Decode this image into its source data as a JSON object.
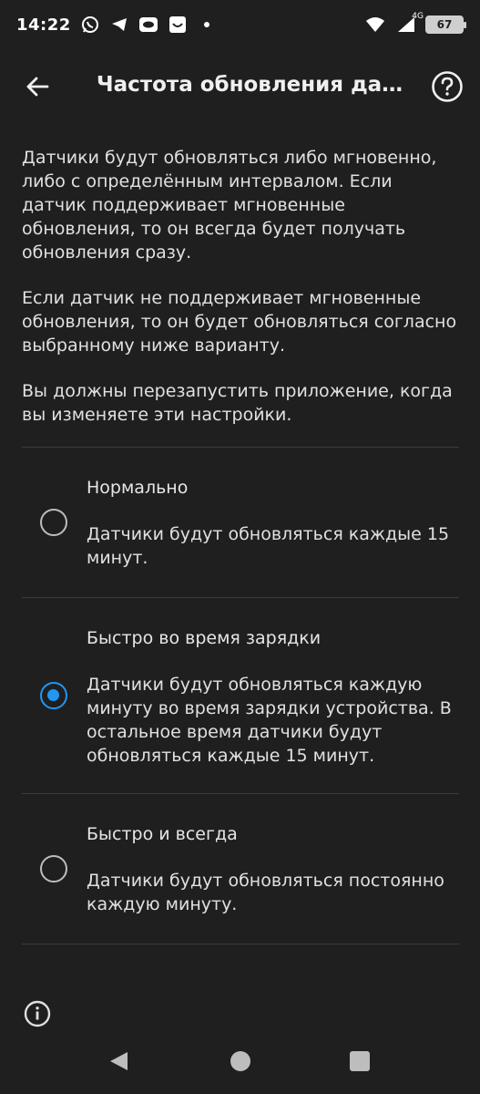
{
  "status": {
    "time": "14:22",
    "network": "4G",
    "battery": "67"
  },
  "app_bar": {
    "title": "Частота обновления датчиков"
  },
  "description": {
    "p1": "Датчики будут обновляться либо мгновенно, либо с определённым интервалом. Если датчик поддерживает мгновенные обновления, то он всегда будет получать обновления сразу.",
    "p2": "Если датчик не поддерживает мгновенные обновления, то он будет обновляться согласно выбранному ниже варианту.",
    "p3": "Вы должны перезапустить приложение, когда вы изменяете эти настройки."
  },
  "options": [
    {
      "title": "Нормально",
      "desc": "Датчики будут обновляться каждые 15 минут.",
      "selected": false
    },
    {
      "title": "Быстро во время зарядки",
      "desc": "Датчики будут обновляться каждую минуту во время зарядки устройства. В остальное время датчики будут обновляться каждые 15 минут.",
      "selected": true
    },
    {
      "title": "Быстро и всегда",
      "desc": "Датчики будут обновляться постоянно каждую минуту.",
      "selected": false
    }
  ],
  "colors": {
    "background": "#1f1f1f",
    "accent": "#2196f3",
    "text": "#e0e0e0"
  }
}
